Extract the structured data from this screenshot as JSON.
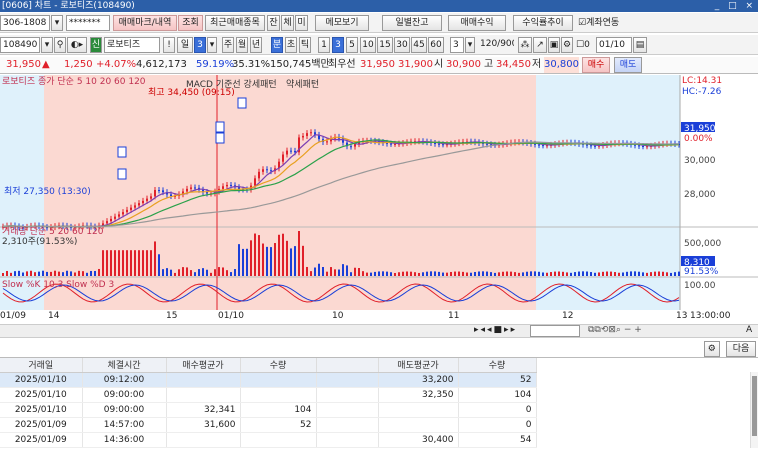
{
  "window": {
    "title": "[0606] 차트 - 로보티즈(108490)",
    "controls": "_ □ ×"
  },
  "toolbar1": {
    "account": "306-1808",
    "password": "*******",
    "btn_mark": "매매마크/내역",
    "btn_query": "조회",
    "btn_recent": "최근매매종목",
    "btn_jan": "잔",
    "btn_che": "체",
    "btn_mi": "미",
    "btn_memo": "메모보기",
    "btn_daily": "일별잔고",
    "btn_profit": "매매수익",
    "btn_rate": "수익률추이",
    "chk_link_label": "계좌연동"
  },
  "toolbar2": {
    "code": "108490",
    "name": "로보티즈",
    "period_day": "일",
    "period_num": "3",
    "periods": [
      "주",
      "월",
      "년",
      "분",
      "초",
      "틱"
    ],
    "minutes": [
      "1",
      "3",
      "5",
      "10",
      "15",
      "30",
      "45",
      "60"
    ],
    "min_sel": "3",
    "count": "120/900",
    "date": "01/10",
    "chk0": "0"
  },
  "quote": {
    "price": "31,950",
    "change": "1,250",
    "rate": "+4.07%",
    "volume": "4,612,173",
    "pct": "59.19%",
    "turnover": "35.31%",
    "amount": "150,745백만",
    "bid_label": "최우선",
    "bid1": "31,950",
    "bid2": "31,900",
    "open_label": "시",
    "open": "30,900",
    "high_label": "고",
    "high": "34,450",
    "low_label": "저",
    "low": "30,800",
    "buy": "매수",
    "sell": "매도"
  },
  "chart_data": {
    "type": "line",
    "legend_text": "로보티즈 종가 단순 5 10 20 60 120",
    "indicators": [
      "MACD 기준선 강세패턴",
      "약세패턴"
    ],
    "high_label": "최고 34,450 (09:15)",
    "low_label": "최저 27,350 (13:30)",
    "right_top1": "LC:14.31",
    "right_top2": "HC:-7.26",
    "y_ticks": [
      "31,950",
      "0.00%",
      "30,000",
      "28,000"
    ],
    "volume_label": "거래량 단순 5 20 60 120",
    "volume_value": "2,310주(91.53%)",
    "volume_ticks": [
      "500,000",
      "8,310",
      "91.53%"
    ],
    "stoch_label": "Slow %K 10,3  Slow %D 3",
    "stoch_ticks": [
      "100.00"
    ],
    "x_labels": [
      "01/09",
      "14",
      "15",
      "01/10",
      "10",
      "11",
      "12",
      "13",
      "13:00:00"
    ]
  },
  "tools": {
    "settings": "⚙",
    "next": "다음"
  },
  "table": {
    "headers": [
      "거래일",
      "체결시간",
      "매수평균가",
      "수량",
      "",
      "매도평균가",
      "수량"
    ],
    "rows": [
      [
        "2025/01/10",
        "09:12:00",
        "",
        "",
        "",
        "33,200",
        "52"
      ],
      [
        "2025/01/10",
        "09:00:00",
        "",
        "",
        "",
        "32,350",
        "104"
      ],
      [
        "2025/01/10",
        "09:00:00",
        "32,341",
        "104",
        "",
        "",
        "0"
      ],
      [
        "2025/01/09",
        "14:57:00",
        "31,600",
        "52",
        "",
        "",
        "0"
      ],
      [
        "2025/01/09",
        "14:36:00",
        "",
        "",
        "",
        "30,400",
        "54"
      ]
    ]
  },
  "colors": {
    "up": "#e0202a",
    "down": "#1a3fd8",
    "ma5": "#7b3fb4",
    "ma10": "#e8a020",
    "ma20": "#2aa14a",
    "ma60": "#999999",
    "bg_pink": "#fbd9d2",
    "bg_blue": "#dff1fb"
  }
}
